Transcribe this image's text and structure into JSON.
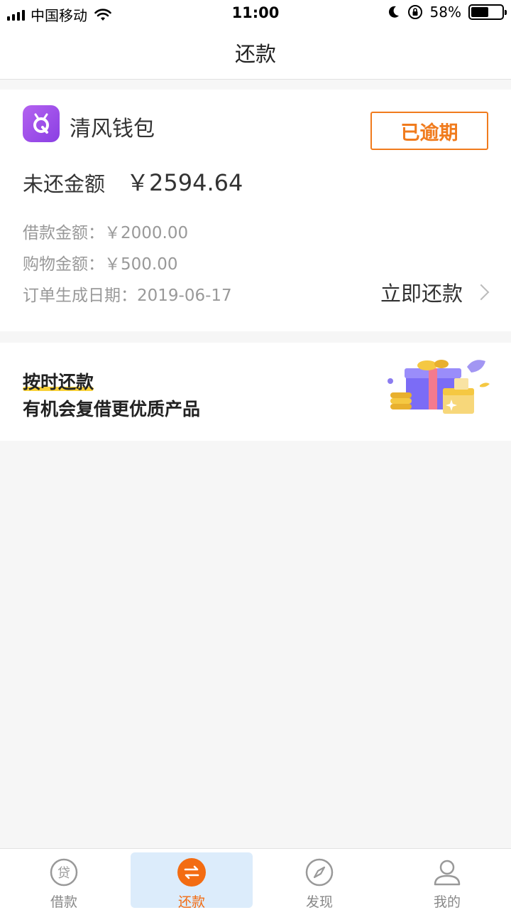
{
  "status_bar": {
    "carrier": "中国移动",
    "time": "11:00",
    "battery": "58%",
    "battery_level": 0.58
  },
  "header": {
    "title": "还款"
  },
  "order": {
    "app_name": "清风钱包",
    "status_badge": "已逾期",
    "unpaid_label": "未还金额",
    "unpaid_amount": "￥2594.64",
    "loan_amount": "借款金额：￥2000.00",
    "shopping_amount": "购物金额：￥500.00",
    "order_date": "订单生成日期：2019-06-17",
    "repay_button": "立即还款"
  },
  "promo": {
    "title": "按时还款",
    "subtitle": "有机会复借更优质产品"
  },
  "tabs": [
    {
      "label": "借款",
      "icon": "loan-icon",
      "active": false
    },
    {
      "label": "还款",
      "icon": "repay-icon",
      "active": true
    },
    {
      "label": "发现",
      "icon": "compass-icon",
      "active": false
    },
    {
      "label": "我的",
      "icon": "profile-icon",
      "active": false
    }
  ],
  "colors": {
    "accent_orange": "#f07b1d",
    "active_tab_bg": "#dcecfb",
    "logo_purple": "#9b4be8",
    "promo_underline": "#f9d23a"
  }
}
